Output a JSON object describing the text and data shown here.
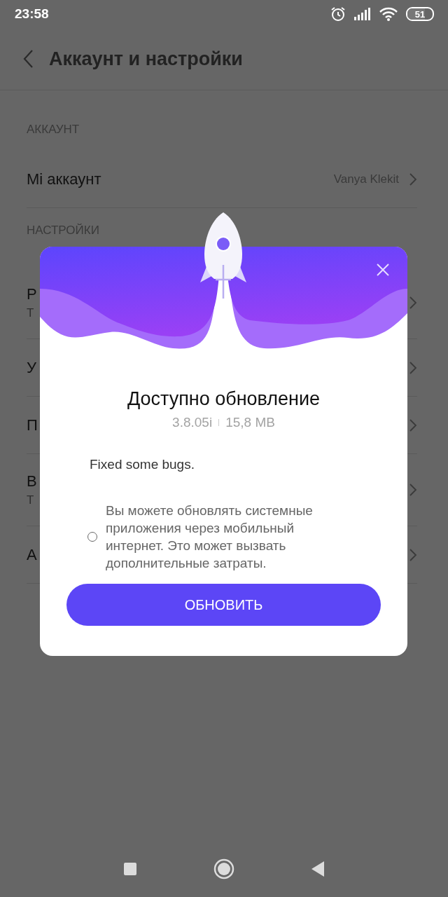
{
  "status_bar": {
    "time": "23:58",
    "battery": "51"
  },
  "header": {
    "title": "Аккаунт и настройки"
  },
  "sections": [
    {
      "title": "АККАУНТ",
      "items": [
        {
          "label": "Mi аккаунт",
          "value": "Vanya Klekit"
        }
      ]
    },
    {
      "title": "НАСТРОЙКИ",
      "items": [
        {
          "label": "Р",
          "subtitle": "Т"
        },
        {
          "label": "У"
        },
        {
          "label": "П"
        },
        {
          "label": "В",
          "subtitle": "Т"
        },
        {
          "label": "А"
        }
      ]
    }
  ],
  "dialog": {
    "title": "Доступно обновление",
    "version": "3.8.05i",
    "size": "15,8 MB",
    "notes": "Fixed some bugs.",
    "option": {
      "text": "Вы можете обновлять системные приложения через мобильный интернет. Это может вызвать дополнительные затраты.",
      "checked": false
    },
    "button": "ОБНОВИТЬ"
  }
}
